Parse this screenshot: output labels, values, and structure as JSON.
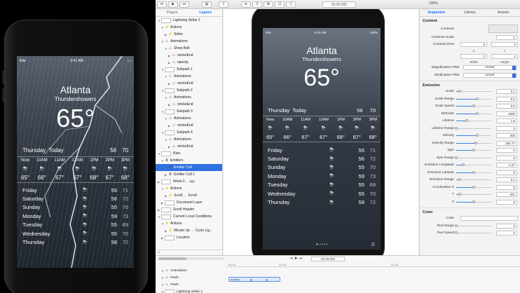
{
  "weather": {
    "carrier": "Kite",
    "time": "9:41 AM",
    "battery": "100%",
    "city": "Atlanta",
    "condition": "Thundershowers",
    "temp": "65°",
    "today": {
      "day": "Thursday",
      "label": "Today",
      "hi": "56",
      "lo": "70"
    },
    "hours": [
      {
        "t": "Now",
        "icon": "⛈",
        "temp": "65°"
      },
      {
        "t": "10AM",
        "icon": "⛈",
        "temp": "66°"
      },
      {
        "t": "11AM",
        "icon": "⛈",
        "temp": "67°"
      },
      {
        "t": "12AM",
        "icon": "⛈",
        "temp": "67°"
      },
      {
        "t": "1PM",
        "icon": "⛈",
        "temp": "68°"
      },
      {
        "t": "2PM",
        "icon": "⛈",
        "temp": "67°"
      },
      {
        "t": "3PM",
        "icon": "⛈",
        "temp": "68°"
      }
    ],
    "days": [
      {
        "name": "Friday",
        "icon": "⛈",
        "hi": "55",
        "lo": "71"
      },
      {
        "name": "Saturday",
        "icon": "⛈",
        "hi": "56",
        "lo": "72"
      },
      {
        "name": "Sunday",
        "icon": "⛈",
        "hi": "55",
        "lo": "70"
      },
      {
        "name": "Monday",
        "icon": "⛈",
        "hi": "59",
        "lo": "73"
      },
      {
        "name": "Tuesday",
        "icon": "⛈",
        "hi": "55",
        "lo": "69"
      },
      {
        "name": "Wednesday",
        "icon": "⛈",
        "hi": "55",
        "lo": "70"
      },
      {
        "name": "Thursday",
        "icon": "⛈",
        "hi": "58",
        "lo": "72"
      }
    ]
  },
  "toolbar": {
    "time": "00:00:000",
    "zoom": "100%"
  },
  "layers": {
    "tabs": [
      "Pages",
      "Layers"
    ],
    "rows": [
      {
        "label": "Lightning Strike 2",
        "kind": "thumb",
        "indent": 0,
        "open": true
      },
      {
        "label": "Actions",
        "kind": "act",
        "indent": 1,
        "open": true
      },
      {
        "label": "Strike",
        "kind": "act",
        "indent": 2
      },
      {
        "label": "Animations",
        "kind": "anim",
        "indent": 1,
        "open": true
      },
      {
        "label": "Show Bolt",
        "kind": "anim",
        "indent": 2,
        "open": true
      },
      {
        "label": "strokeEnd",
        "kind": "anim",
        "indent": 3
      },
      {
        "label": "opacity",
        "kind": "anim",
        "indent": 3
      },
      {
        "label": "Subpath 1",
        "kind": "thumb",
        "indent": 1,
        "open": true
      },
      {
        "label": "Animations",
        "kind": "anim",
        "indent": 2,
        "open": true
      },
      {
        "label": "strokeEnd",
        "kind": "anim",
        "indent": 3
      },
      {
        "label": "Subpath 2",
        "kind": "thumb",
        "indent": 1,
        "open": true
      },
      {
        "label": "Animations",
        "kind": "anim",
        "indent": 2,
        "open": true
      },
      {
        "label": "strokeEnd",
        "kind": "anim",
        "indent": 3
      },
      {
        "label": "Subpath 3",
        "kind": "thumb",
        "indent": 1,
        "open": true
      },
      {
        "label": "Animations",
        "kind": "anim",
        "indent": 2,
        "open": true
      },
      {
        "label": "strokeEnd",
        "kind": "anim",
        "indent": 3
      },
      {
        "label": "Subpath 4",
        "kind": "thumb",
        "indent": 1,
        "open": true
      },
      {
        "label": "Animations",
        "kind": "anim",
        "indent": 2,
        "open": true
      },
      {
        "label": "strokeEnd",
        "kind": "anim",
        "indent": 3
      },
      {
        "label": "Rain",
        "kind": "thumb",
        "indent": 0,
        "open": true
      },
      {
        "label": "Emitters",
        "kind": "emit",
        "indent": 1,
        "open": true
      },
      {
        "label": "Emitter Cell",
        "kind": "emit",
        "indent": 2,
        "selected": true
      },
      {
        "label": "Emitter Cell 1",
        "kind": "emit",
        "indent": 2
      },
      {
        "label": "Week F...",
        "kind": "thumb",
        "indent": 0,
        "badge": "TXT"
      },
      {
        "label": "Actions",
        "kind": "act",
        "indent": 1,
        "open": true
      },
      {
        "label": "Scroll → Scroll",
        "kind": "act",
        "indent": 2
      },
      {
        "label": "Document Layer",
        "kind": "thumb",
        "indent": 1
      },
      {
        "label": "Scroll Header",
        "kind": "thumb",
        "indent": 0
      },
      {
        "label": "Current Local Conditions",
        "kind": "thumb",
        "indent": 0,
        "open": true
      },
      {
        "label": "Actions",
        "kind": "act",
        "indent": 1,
        "open": true
      },
      {
        "label": "Mouse Up → Cycle Lig...",
        "kind": "act",
        "indent": 2
      },
      {
        "label": "Location",
        "kind": "thumb",
        "indent": 1
      }
    ]
  },
  "inspector": {
    "tabs": [
      "Inspector",
      "Library",
      "Assets"
    ],
    "content_title": "Content",
    "contents_label": "Contents",
    "contents_scale": {
      "label": "Contents Scale",
      "value": "1"
    },
    "contents_rect": {
      "label": "Contents Rect",
      "x": "0",
      "y": "0",
      "w": "1",
      "h": "1",
      "xl": "X",
      "yl": "Y",
      "wl": "Width",
      "hl": "Height"
    },
    "mag_filter": {
      "label": "Magnification Filter",
      "value": "Linear"
    },
    "min_filter": {
      "label": "Minification Filter",
      "value": "Linear"
    },
    "emission_title": "Emission",
    "params": [
      {
        "label": "Scale",
        "value": "0.1",
        "pos": 0.1
      },
      {
        "label": "Scale Range",
        "value": "0.6",
        "pos": 0.6
      },
      {
        "label": "Scale Speed",
        "value": "0.5",
        "pos": 0.5
      },
      {
        "label": "Birthrate",
        "value": "1500",
        "pos": 0.6
      },
      {
        "label": "Lifetime",
        "value": "1.5",
        "pos": 0.3
      },
      {
        "label": "Lifetime Range",
        "value": "0",
        "pos": 0.0
      },
      {
        "label": "Velocity",
        "value": "300",
        "pos": 0.6
      },
      {
        "label": "Velocity Range",
        "value": "250.77",
        "pos": 0.55
      },
      {
        "label": "Spin",
        "value": "0",
        "pos": 0.5
      },
      {
        "label": "Spin Range",
        "value": "0",
        "pos": 0.0
      },
      {
        "label": "Emission Longitude",
        "value": "-1.67",
        "pos": 0.2
      },
      {
        "label": "Emission Latitude",
        "value": "0",
        "pos": 0.5
      },
      {
        "label": "Emission Range",
        "value": "0.1",
        "pos": 0.1
      }
    ],
    "accel": {
      "label": "Acceleration",
      "x": "0",
      "y": "-401",
      "z": "0",
      "xl": "X",
      "yl": "Y",
      "zl": "Z",
      "xpos": 0.5,
      "ypos": 0.1,
      "zpos": 0.5
    },
    "color_title": "Color",
    "color": {
      "label": "Color"
    },
    "color_params": [
      {
        "label": "Red Range",
        "value": "0",
        "pos": 0.0
      },
      {
        "label": "Red Speed",
        "value": "0",
        "pos": 0.0
      }
    ]
  },
  "timeline": {
    "time": "00:00:000",
    "ruler": [
      "00:00",
      "00:05",
      "00:06"
    ],
    "rows": [
      {
        "label": "Animations",
        "kind": "anim"
      },
      {
        "label": "Flash",
        "kind": "anim"
      },
      {
        "label": "Flash",
        "kind": "anim"
      },
      {
        "label": "Lightning Strike 2",
        "kind": "thumb"
      }
    ],
    "clip": "opacity"
  }
}
